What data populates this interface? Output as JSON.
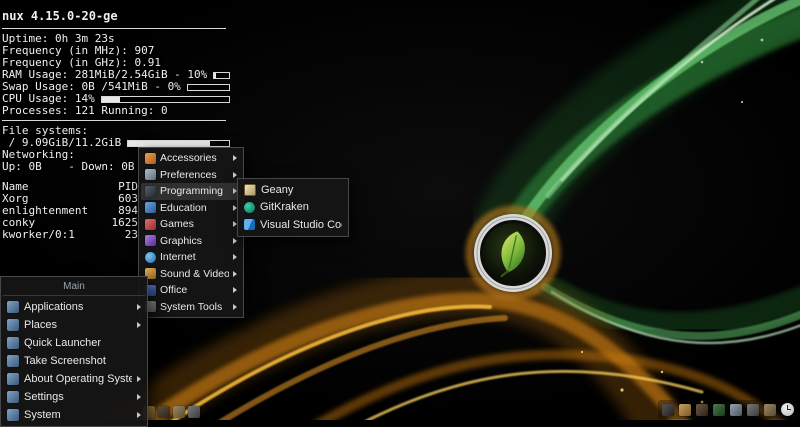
{
  "conky": {
    "kernel": "nux 4.15.0-20-ge",
    "uptime": "Uptime: 0h 3m 23s",
    "freq_mhz": "Frequency (in MHz): 907",
    "freq_ghz": "Frequency (in GHz): 0.91",
    "ram_label": "RAM Usage: 281MiB/2.54GiB - 10%",
    "ram_pct": 10,
    "swap_label": "Swap Usage: 0B /541MiB - 0%",
    "swap_pct": 0,
    "cpu_label": "CPU Usage: 14%",
    "cpu_pct": 14,
    "processes": "Processes: 121 Running: 0",
    "fs_header": "File systems:",
    "fs_label": " / 9.09GiB/11.2GiB",
    "fs_pct": 81,
    "net_header": "Networking:",
    "net_line": "Up: 0B    - Down: 0B",
    "proc_headers": {
      "name": "Name",
      "pid": "PID"
    },
    "processes_list": [
      {
        "name": "Xorg",
        "pid": "603"
      },
      {
        "name": "enlightenment",
        "pid": "894"
      },
      {
        "name": "conky",
        "pid": "1625"
      },
      {
        "name": "kworker/0:1",
        "pid": "23"
      }
    ]
  },
  "main_menu": {
    "header": "Main",
    "items": [
      {
        "label": "Applications",
        "has_submenu": true
      },
      {
        "label": "Places",
        "has_submenu": true
      },
      {
        "label": "Quick Launcher",
        "has_submenu": false
      },
      {
        "label": "Take Screenshot",
        "has_submenu": false
      },
      {
        "label": "About Operating System",
        "has_submenu": true
      },
      {
        "label": "Settings",
        "has_submenu": true
      },
      {
        "label": "System",
        "has_submenu": true
      }
    ]
  },
  "apps_menu": {
    "items": [
      {
        "label": "Accessories"
      },
      {
        "label": "Preferences"
      },
      {
        "label": "Programming"
      },
      {
        "label": "Education"
      },
      {
        "label": "Games"
      },
      {
        "label": "Graphics"
      },
      {
        "label": "Internet"
      },
      {
        "label": "Sound & Video"
      },
      {
        "label": "Office"
      },
      {
        "label": "System Tools"
      }
    ]
  },
  "programming_menu": {
    "items": [
      {
        "label": "Geany"
      },
      {
        "label": "GitKraken"
      },
      {
        "label": "Visual Studio Code"
      }
    ]
  },
  "shelf": {
    "right_icons": [
      "window-list-icon",
      "files-icon",
      "terminal-icon",
      "cpu-monitor-icon",
      "mixer-icon",
      "battery-icon",
      "pager-icon",
      "clock-icon"
    ],
    "left_icons": [
      "app-icon-1",
      "app-icon-2",
      "app-icon-3",
      "app-icon-4"
    ]
  },
  "colors": {
    "wallpaper_green": "#3fae49",
    "wallpaper_orange": "#f39c12",
    "menu_background": "#161616",
    "conky_text": "#efefef"
  }
}
